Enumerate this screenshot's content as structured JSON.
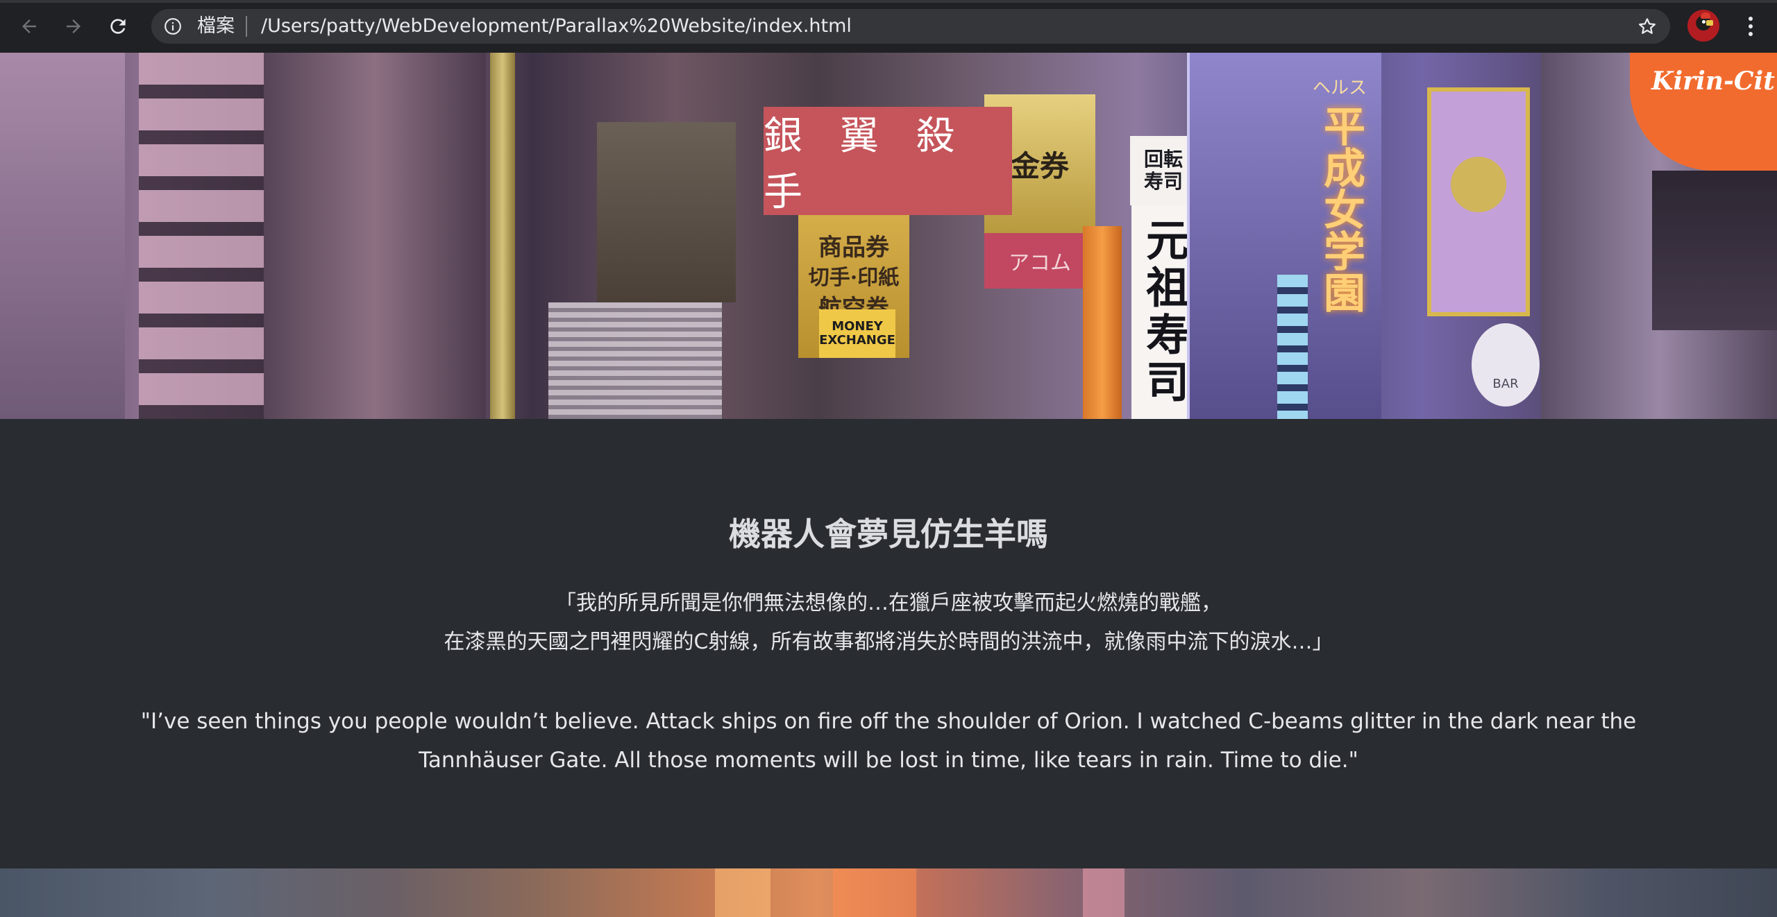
{
  "browser": {
    "scheme_label": "檔案",
    "url": "/Users/patty/WebDevelopment/Parallax%20Website/index.html",
    "icons": [
      "back-arrow-icon",
      "forward-arrow-icon",
      "reload-icon",
      "info-icon",
      "bookmark-star-icon",
      "profile-avatar-icon",
      "more-vert-icon"
    ]
  },
  "hero": {
    "title": "銀 翼 殺 手",
    "title_bg": "#c5555b",
    "signs": {
      "money_exchange": "MONEY EXCHANGE",
      "kirin": "Kirin-Cit",
      "helth": "ヘルス",
      "heisei": "平成女学園",
      "ganso_sushi": "元祖寿司",
      "kaiten": "回転",
      "sushi_small": "寿司",
      "bar": "BAR",
      "shohin": "商品券",
      "kitte": "切手·印紙",
      "kokuu": "航空券",
      "kin": "金券",
      "acom": "アコム"
    }
  },
  "content": {
    "heading": "機器人會夢見仿生羊嗎",
    "quote_zh_line1": "「我的所見所聞是你們無法想像的…在獵戶座被攻擊而起火燃燒的戰艦，",
    "quote_zh_line2": "在漆黑的天國之門裡閃耀的C射線，所有故事都將消失於時間的洪流中，就像雨中流下的淚水…」",
    "quote_en": "\"I’ve seen things you people wouldn’t believe. Attack ships on fire off the shoulder of Orion. I watched C-beams glitter in the dark near the Tannhäuser Gate. All those moments will be lost in time, like tears in rain. Time to die.\""
  }
}
